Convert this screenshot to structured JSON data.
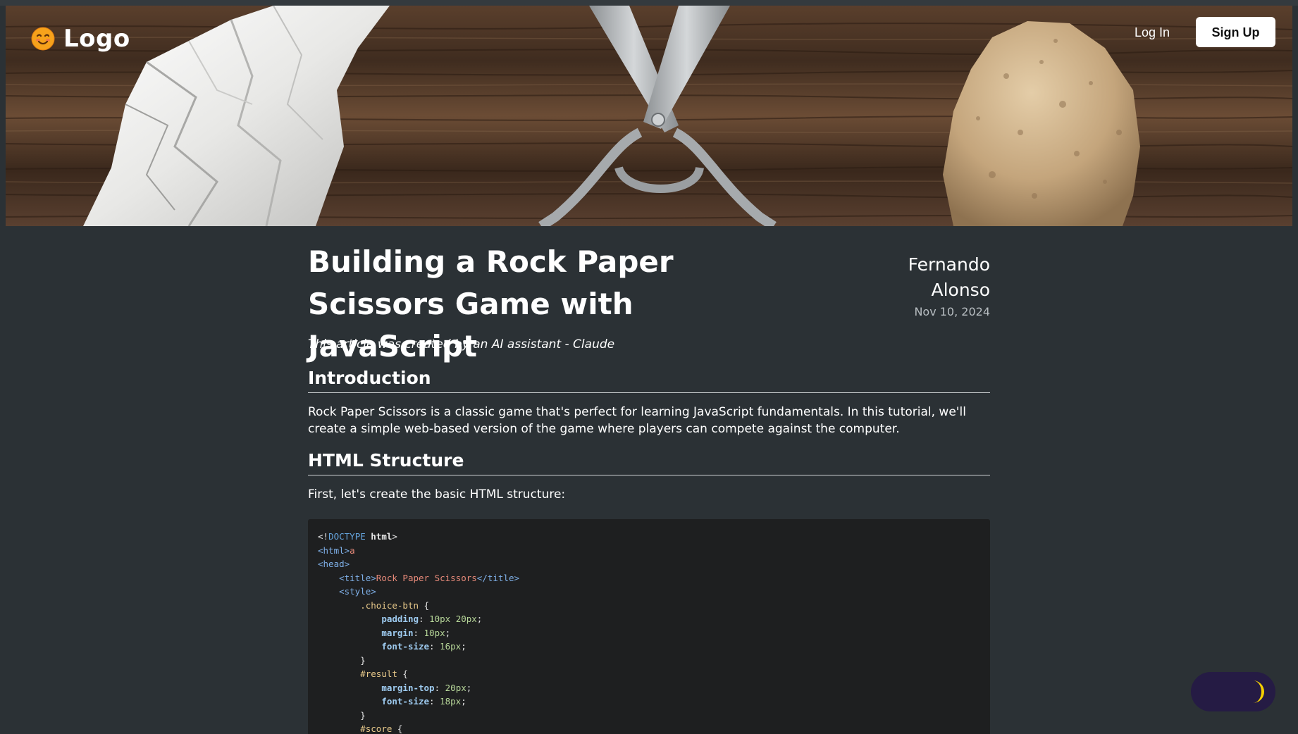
{
  "nav": {
    "logo_text": "Logo",
    "login_label": "Log In",
    "signup_label": "Sign Up"
  },
  "article": {
    "title": "Building a Rock Paper Scissors Game with JavaScript",
    "author": "Fernando Alonso",
    "date": "Nov 10, 2024",
    "disclaimer": "This article was created by an AI assistant - Claude",
    "sections": [
      {
        "heading": "Introduction",
        "paragraph": "Rock Paper Scissors is a classic game that's perfect for learning JavaScript fundamentals. In this tutorial, we'll create a simple web-based version of the game where players can compete against the computer."
      },
      {
        "heading": "HTML Structure",
        "paragraph": "First, let's create the basic HTML structure:"
      }
    ],
    "code_lines": [
      [
        {
          "t": "<!",
          "c": "punc"
        },
        {
          "t": "DOCTYPE",
          "c": "doct"
        },
        {
          "t": " ",
          "c": "punc"
        },
        {
          "t": "html",
          "c": "kw"
        },
        {
          "t": ">",
          "c": "punc"
        }
      ],
      [
        {
          "t": "<html>",
          "c": "tag"
        },
        {
          "t": "a",
          "c": "str"
        }
      ],
      [
        {
          "t": "<head>",
          "c": "tag"
        }
      ],
      [
        {
          "t": "    ",
          "c": "punc"
        },
        {
          "t": "<title>",
          "c": "tag"
        },
        {
          "t": "Rock Paper Scissors",
          "c": "str"
        },
        {
          "t": "</title>",
          "c": "tag"
        }
      ],
      [
        {
          "t": "    ",
          "c": "punc"
        },
        {
          "t": "<style>",
          "c": "tag"
        }
      ],
      [
        {
          "t": "        ",
          "c": "punc"
        },
        {
          "t": ".choice-btn",
          "c": "sel"
        },
        {
          "t": " {",
          "c": "punc"
        }
      ],
      [
        {
          "t": "            ",
          "c": "punc"
        },
        {
          "t": "padding",
          "c": "prop"
        },
        {
          "t": ": ",
          "c": "punc"
        },
        {
          "t": "10px 20px",
          "c": "num"
        },
        {
          "t": ";",
          "c": "punc"
        }
      ],
      [
        {
          "t": "            ",
          "c": "punc"
        },
        {
          "t": "margin",
          "c": "prop"
        },
        {
          "t": ": ",
          "c": "punc"
        },
        {
          "t": "10px",
          "c": "num"
        },
        {
          "t": ";",
          "c": "punc"
        }
      ],
      [
        {
          "t": "            ",
          "c": "punc"
        },
        {
          "t": "font-size",
          "c": "prop"
        },
        {
          "t": ": ",
          "c": "punc"
        },
        {
          "t": "16px",
          "c": "num"
        },
        {
          "t": ";",
          "c": "punc"
        }
      ],
      [
        {
          "t": "        }",
          "c": "punc"
        }
      ],
      [
        {
          "t": "        ",
          "c": "punc"
        },
        {
          "t": "#result",
          "c": "sel"
        },
        {
          "t": " {",
          "c": "punc"
        }
      ],
      [
        {
          "t": "            ",
          "c": "punc"
        },
        {
          "t": "margin-top",
          "c": "prop"
        },
        {
          "t": ": ",
          "c": "punc"
        },
        {
          "t": "20px",
          "c": "num"
        },
        {
          "t": ";",
          "c": "punc"
        }
      ],
      [
        {
          "t": "            ",
          "c": "punc"
        },
        {
          "t": "font-size",
          "c": "prop"
        },
        {
          "t": ": ",
          "c": "punc"
        },
        {
          "t": "18px",
          "c": "num"
        },
        {
          "t": ";",
          "c": "punc"
        }
      ],
      [
        {
          "t": "        }",
          "c": "punc"
        }
      ],
      [
        {
          "t": "        ",
          "c": "punc"
        },
        {
          "t": "#score",
          "c": "sel"
        },
        {
          "t": " {",
          "c": "punc"
        }
      ]
    ]
  },
  "hero": {
    "image_description_icon": "rock-paper-scissors-hero-image",
    "colors": {
      "wood_dark": "#3b2a1e",
      "wood_light": "#6b4e37",
      "paper": "#f2f2f0",
      "metal": "#b9bcbf",
      "rock": "#c9ad86"
    }
  },
  "theme_toggle": {
    "icon": "moon-icon",
    "mode": "dark",
    "track_color": "#251b44",
    "moon_color": "#f5d000"
  },
  "colors": {
    "background": "#2b3135",
    "code_background": "#1e1f20",
    "text": "#ffffff",
    "muted": "#b8bec2"
  }
}
